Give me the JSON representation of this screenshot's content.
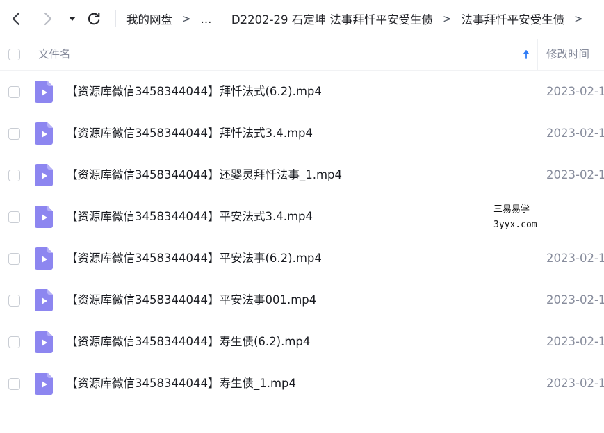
{
  "navbar": {
    "back_icon": "chevron-left-icon",
    "forward_icon": "chevron-right-icon",
    "dropdown_icon": "caret-down-icon",
    "refresh_icon": "refresh-icon",
    "breadcrumb": [
      {
        "label": "我的网盘"
      },
      {
        "label": "..."
      },
      {
        "label": "D2202-29 石定坤 法事拜忏平安受生债"
      },
      {
        "label": "法事拜忏平安受生债"
      }
    ],
    "separator": ">"
  },
  "list": {
    "columns": {
      "name": "文件名",
      "date": "修改时间",
      "sort_icon": "sort-ascending-arrow-icon"
    },
    "rows": [
      {
        "name": "【资源库微信3458344044】拜忏法式(6.2).mp4",
        "date": "2023-02-1",
        "icon": "video-file-icon"
      },
      {
        "name": "【资源库微信3458344044】拜忏法式3.4.mp4",
        "date": "2023-02-1",
        "icon": "video-file-icon"
      },
      {
        "name": "【资源库微信3458344044】还婴灵拜忏法事_1.mp4",
        "date": "2023-02-1",
        "icon": "video-file-icon"
      },
      {
        "name": "【资源库微信3458344044】平安法式3.4.mp4",
        "date": "",
        "icon": "video-file-icon"
      },
      {
        "name": "【资源库微信3458344044】平安法事(6.2).mp4",
        "date": "2023-02-1",
        "icon": "video-file-icon"
      },
      {
        "name": "【资源库微信3458344044】平安法事001.mp4",
        "date": "2023-02-1",
        "icon": "video-file-icon"
      },
      {
        "name": "【资源库微信3458344044】寿生债(6.2).mp4",
        "date": "2023-02-1",
        "icon": "video-file-icon"
      },
      {
        "name": "【资源库微信3458344044】寿生债_1.mp4",
        "date": "2023-02-1",
        "icon": "video-file-icon"
      }
    ]
  },
  "watermark": {
    "line1": "三易易学",
    "line2": "3yyx.com"
  },
  "colors": {
    "file_icon": "#8d86f0",
    "accent_arrow": "#2f7cf6",
    "muted_text": "#878c9c"
  }
}
